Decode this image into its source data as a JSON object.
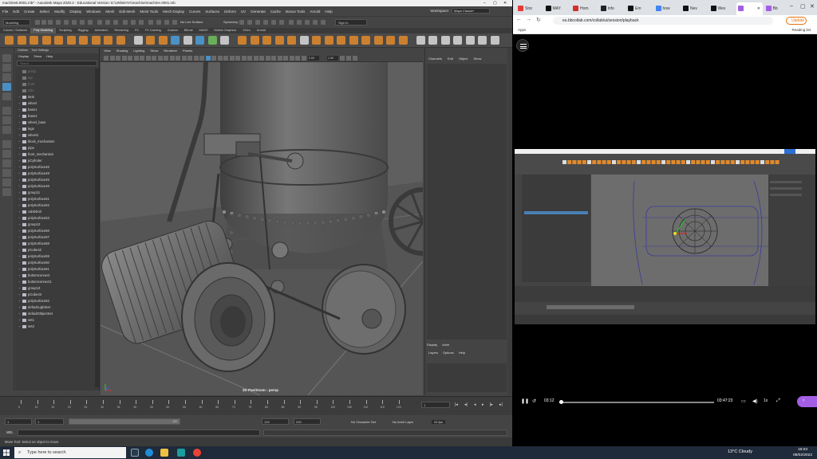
{
  "maya": {
    "title": "machine5.0001.mb* - Autodesk Maya 2020.2 - Educational Version: E:\\UN\\MAYA\\machine\\machine.0001.mb",
    "menus": [
      "File",
      "Edit",
      "Create",
      "Select",
      "Modify",
      "Display",
      "Windows",
      "Mesh",
      "Edit Mesh",
      "Mesh Tools",
      "Mesh Display",
      "Curves",
      "Surfaces",
      "Deform",
      "UV",
      "Generate",
      "Cache",
      "Bonus Tools",
      "Arnold",
      "Help"
    ],
    "workspace_label": "Workspace:",
    "workspace_value": "Maya Classic*",
    "mode_menu": "Modeling",
    "no_live_surface": "No Live Surface",
    "symmetry": "Symmetry: Off",
    "sign_in": "Sign In",
    "shelf_tabs": [
      "Curves / Surfaces",
      "Poly Modeling",
      "Sculpting",
      "Rigging",
      "Animation",
      "Rendering",
      "FX",
      "FX Caching",
      "Custom",
      "Bifrost",
      "MASH",
      "Motion Graphics",
      "XGen",
      "Arnold"
    ],
    "shelf_active": "Poly Modeling",
    "outliner": {
      "tabs": [
        "Outliner",
        "Tool Settings"
      ],
      "menus": [
        "Display",
        "Show",
        "Help"
      ],
      "search_placeholder": "Search...",
      "items": [
        {
          "name": "persp",
          "dim": true
        },
        {
          "name": "top",
          "dim": true
        },
        {
          "name": "front",
          "dim": true
        },
        {
          "name": "side",
          "dim": true
        },
        {
          "name": "tank",
          "dim": false
        },
        {
          "name": "wheel",
          "dim": false
        },
        {
          "name": "base1",
          "dim": false
        },
        {
          "name": "base2",
          "dim": false
        },
        {
          "name": "wheel_base",
          "dim": false
        },
        {
          "name": "legs",
          "dim": false
        },
        {
          "name": "wheel1",
          "dim": false
        },
        {
          "name": "block_mechanism",
          "dim": false
        },
        {
          "name": "pipe",
          "dim": false
        },
        {
          "name": "front_mechanism",
          "dim": false
        },
        {
          "name": "pCylinder",
          "dim": false
        },
        {
          "name": "polySurface46",
          "dim": false
        },
        {
          "name": "polySurface48",
          "dim": false
        },
        {
          "name": "polySurface45",
          "dim": false
        },
        {
          "name": "polySurface46",
          "dim": false
        },
        {
          "name": "group11",
          "dim": false
        },
        {
          "name": "polySurface51",
          "dim": false
        },
        {
          "name": "polySurface52",
          "dim": false
        },
        {
          "name": "cablebolt",
          "dim": false
        },
        {
          "name": "polySurface53",
          "dim": false
        },
        {
          "name": "group12",
          "dim": false
        },
        {
          "name": "polySurface56",
          "dim": false
        },
        {
          "name": "polySurface57",
          "dim": false
        },
        {
          "name": "polySurface58",
          "dim": false
        },
        {
          "name": "pCube42",
          "dim": false
        },
        {
          "name": "polySurface59",
          "dim": false
        },
        {
          "name": "polySurface60",
          "dim": false
        },
        {
          "name": "polySurface61",
          "dim": false
        },
        {
          "name": "bottomconnect",
          "dim": false
        },
        {
          "name": "bottomconnect1",
          "dim": false
        },
        {
          "name": "group13",
          "dim": false
        },
        {
          "name": "pCube43",
          "dim": false
        },
        {
          "name": "polySurface62",
          "dim": false
        },
        {
          "name": "defaultLightSet",
          "dim": false
        },
        {
          "name": "defaultObjectSet",
          "dim": false
        },
        {
          "name": "set1",
          "dim": false
        },
        {
          "name": "set2",
          "dim": false
        }
      ]
    },
    "viewport": {
      "menus": [
        "View",
        "Shading",
        "Lighting",
        "Show",
        "Renderer",
        "Panels"
      ],
      "field_a": "0.00",
      "field_b": "1.00",
      "overlay_label": "2D Pan/Zoom : persp"
    },
    "channel_box": {
      "menus": [
        "Channels",
        "Edit",
        "Object",
        "Show"
      ],
      "display_tabs": [
        "Display",
        "Anim"
      ],
      "display_menus": [
        "Layers",
        "Options",
        "Help"
      ]
    },
    "side_tabs": [
      "Channel Box / Layer Editor",
      "Modeling Toolkit",
      "Attribute Editor"
    ],
    "timeline": {
      "ticks": [
        "5",
        "10",
        "15",
        "20",
        "25",
        "30",
        "35",
        "40",
        "45",
        "50",
        "55",
        "60",
        "65",
        "70",
        "75",
        "80",
        "85",
        "90",
        "95",
        "100",
        "105",
        "110",
        "115",
        "120"
      ],
      "current_frame": "1",
      "range_start": "1",
      "range_inner_start": "1",
      "range_bar_label": "120",
      "range_inner_end": "120",
      "range_end": "200",
      "character_set": "No Character Set",
      "anim_layer": "No Anim Layer",
      "fps": "24 fps"
    },
    "command_label": "MEL",
    "help_line": "Move Tool: Select an object to move."
  },
  "browser": {
    "tabs": [
      {
        "label": "Stor",
        "color": "#e53935"
      },
      {
        "label": "MAY",
        "color": "#111111"
      },
      {
        "label": "Hom",
        "color": "#d32f2f"
      },
      {
        "label": "Info",
        "color": "#222222"
      },
      {
        "label": "Em",
        "color": "#111111"
      },
      {
        "label": "how",
        "color": "#4285f4"
      },
      {
        "label": "Nev",
        "color": "#111111"
      },
      {
        "label": "Wes",
        "color": "#111111"
      },
      {
        "label": "",
        "color": "#a45ee5"
      },
      {
        "label": "Bb",
        "color": "#a45ee5"
      }
    ],
    "url": "eu.bbcollab.com/collab/ui/session/playback",
    "update_label": "Update",
    "apps_label": "Apps",
    "reading_list": "Reading list",
    "player": {
      "current_time": "03:12",
      "duration": "03:47:23",
      "speed": "1x",
      "progress": 0.01
    }
  },
  "taskbar": {
    "search_placeholder": "Type here to search",
    "weather": "13°C  Cloudy",
    "time": "16:03",
    "date": "08/02/2022"
  }
}
